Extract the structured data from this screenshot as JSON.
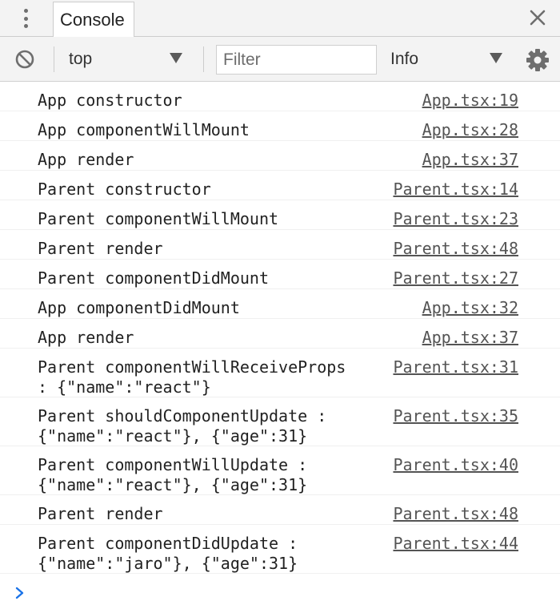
{
  "tabbar": {
    "tab_label": "Console"
  },
  "toolbar": {
    "context": "top",
    "filter_placeholder": "Filter",
    "level": "Info"
  },
  "messages": [
    {
      "text": "App constructor",
      "source": "App.tsx:19"
    },
    {
      "text": "App componentWillMount",
      "source": "App.tsx:28"
    },
    {
      "text": "App render",
      "source": "App.tsx:37"
    },
    {
      "text": "Parent constructor",
      "source": "Parent.tsx:14"
    },
    {
      "text": "Parent componentWillMount",
      "source": "Parent.tsx:23"
    },
    {
      "text": "Parent render",
      "source": "Parent.tsx:48"
    },
    {
      "text": "Parent componentDidMount",
      "source": "Parent.tsx:27"
    },
    {
      "text": "App componentDidMount",
      "source": "App.tsx:32"
    },
    {
      "text": "App render",
      "source": "App.tsx:37"
    },
    {
      "text": "Parent componentWillReceiveProps\n: {\"name\":\"react\"}",
      "source": "Parent.tsx:31"
    },
    {
      "text": "Parent shouldComponentUpdate :\n{\"name\":\"react\"}, {\"age\":31}",
      "source": "Parent.tsx:35"
    },
    {
      "text": "Parent componentWillUpdate :\n{\"name\":\"react\"}, {\"age\":31}",
      "source": "Parent.tsx:40"
    },
    {
      "text": "Parent render",
      "source": "Parent.tsx:48"
    },
    {
      "text": "Parent componentDidUpdate :\n{\"name\":\"jaro\"}, {\"age\":31}",
      "source": "Parent.tsx:44"
    }
  ],
  "colors": {
    "prompt": "#1a73e8",
    "icon": "#6e6e6e"
  }
}
